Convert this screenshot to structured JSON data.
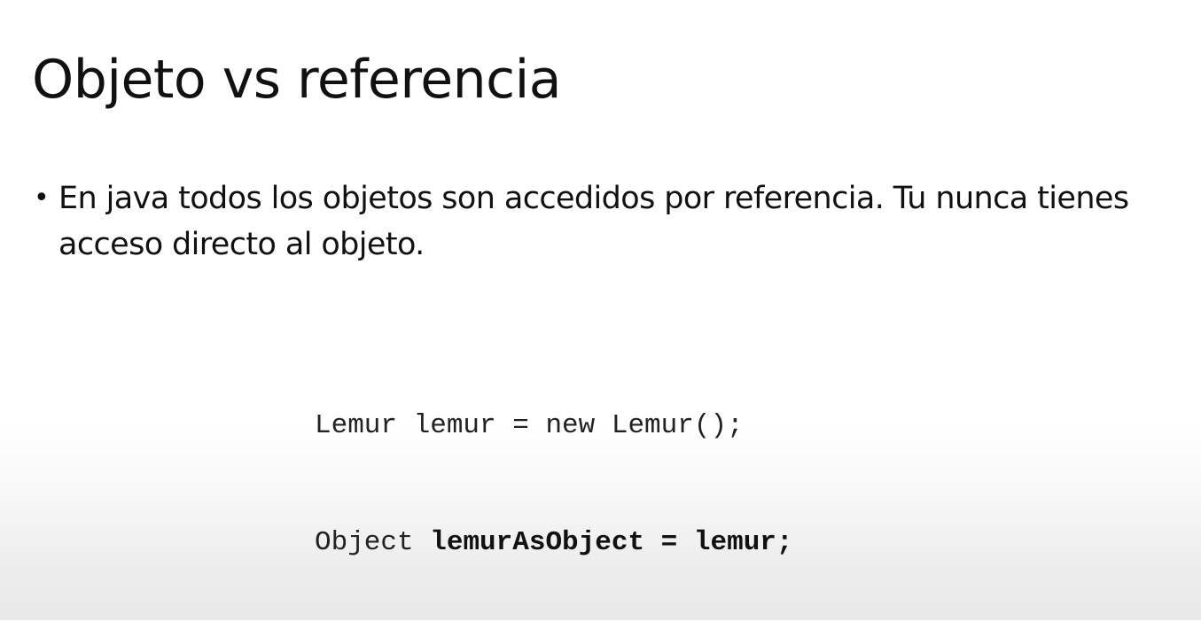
{
  "slide": {
    "title": "Objeto vs referencia",
    "bullets": [
      {
        "marker": "•",
        "text": "En java todos los objetos son accedidos por referencia. Tu nunca tienes acceso directo al objeto."
      }
    ],
    "code": {
      "line1": "Lemur lemur = new Lemur();",
      "line2_normal": "Object ",
      "line2_bold": "lemurAsObject = lemur;"
    }
  }
}
